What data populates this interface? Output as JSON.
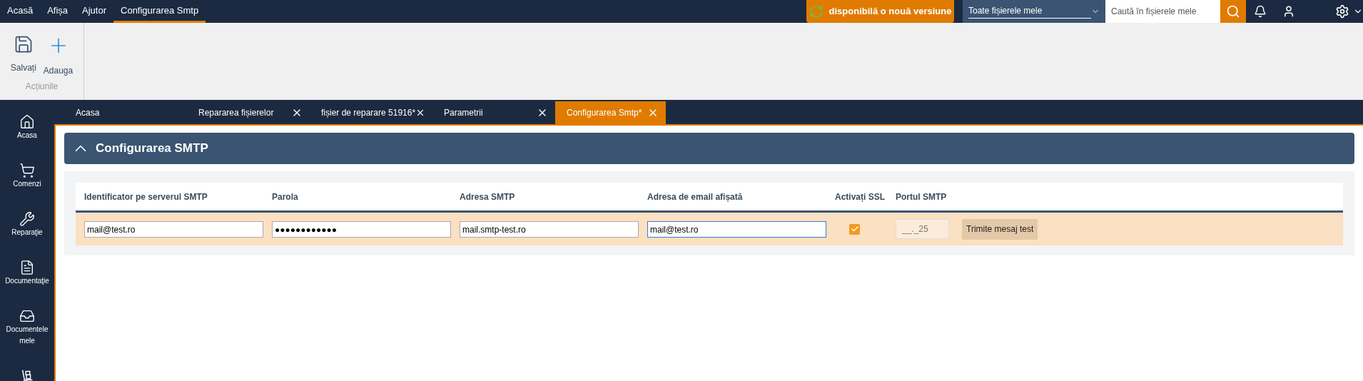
{
  "menu": [
    {
      "label": "Acasă",
      "selected": false
    },
    {
      "label": "Afișa",
      "selected": false
    },
    {
      "label": "Ajutor",
      "selected": false
    },
    {
      "label": "Configurarea Smtp",
      "selected": true
    }
  ],
  "update_banner": "disponibilă o nouă versiune",
  "scope_select": {
    "value": "Toate fișierele mele"
  },
  "search": {
    "placeholder": "Caută în fișierele mele"
  },
  "ribbon": {
    "buttons": [
      {
        "kind": "save",
        "label": "Salvați"
      },
      {
        "kind": "add",
        "label": "Adauga"
      }
    ],
    "group": "Acțiunile"
  },
  "sidebar": {
    "items": [
      {
        "kind": "home",
        "label": "Acasa"
      },
      {
        "kind": "cart",
        "label": "Comenzi"
      },
      {
        "kind": "wrench",
        "label": "Reparaţie"
      },
      {
        "kind": "doc",
        "label": "Documentaţie"
      },
      {
        "kind": "inbox",
        "label": "Documentele mele"
      },
      {
        "kind": "trolley"
      }
    ]
  },
  "tabs": [
    {
      "label": "Acasa",
      "closable": false,
      "selected": false
    },
    {
      "label": "Repararea fișierelor",
      "closable": true,
      "selected": false
    },
    {
      "label": "fișier de reparare 51916*",
      "closable": true,
      "selected": false
    },
    {
      "label": "Parametrii",
      "closable": true,
      "selected": false
    },
    {
      "label": "Configurarea Smtp*",
      "closable": true,
      "selected": true
    }
  ],
  "panel": {
    "title": "Configurarea SMTP",
    "expanded": true
  },
  "table": {
    "columns": [
      "Identificator pe serverul SMTP",
      "Parola",
      "Adresa SMTP",
      "Adresa de email afișată",
      "Activați SSL",
      "Portul SMTP"
    ],
    "row": {
      "server_id": "mail@test.ro",
      "password": "●●●●●●●●●●●●",
      "smtp_address": "mail.smtp-test.ro",
      "display_email": "mail@test.ro",
      "ssl": true,
      "port": "__._25",
      "test_button": "Trimite mesaj test"
    }
  }
}
